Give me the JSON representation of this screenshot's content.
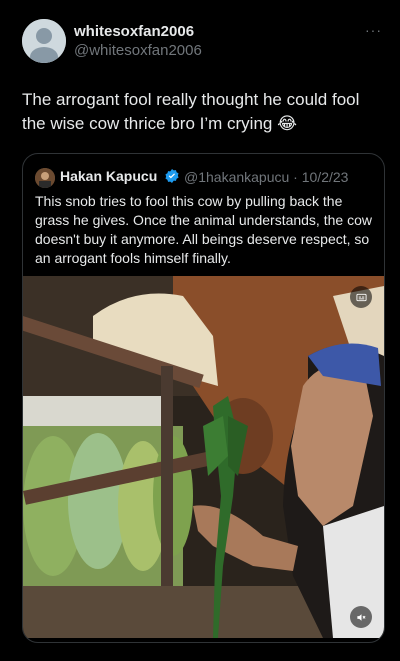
{
  "tweet": {
    "author_name": "whitesoxfan2006",
    "author_handle": "@whitesoxfan2006",
    "more_label": "···",
    "text": "The arrogant fool really thought he could fool the wise cow thrice bro I’m crying 😂"
  },
  "quoted": {
    "author_name": "Hakan Kapucu",
    "meta": "@1hakankapucu · 10/2/23",
    "text": "This snob tries to fool this cow by pulling back the grass he gives. Once the animal understands, the cow doesn't buy it anymore. All beings deserve respect, so an arrogant fools himself finally."
  },
  "icons": {
    "avatar": "default-user-icon",
    "verified": "verified-badge-icon",
    "media_top_right": "caption-icon",
    "media_bottom_right": "speaker-muted-icon"
  },
  "colors": {
    "background": "#000000",
    "text_primary": "#e7e9ea",
    "text_secondary": "#71767b",
    "border": "#2f3336",
    "verified": "#1d9bf0"
  }
}
